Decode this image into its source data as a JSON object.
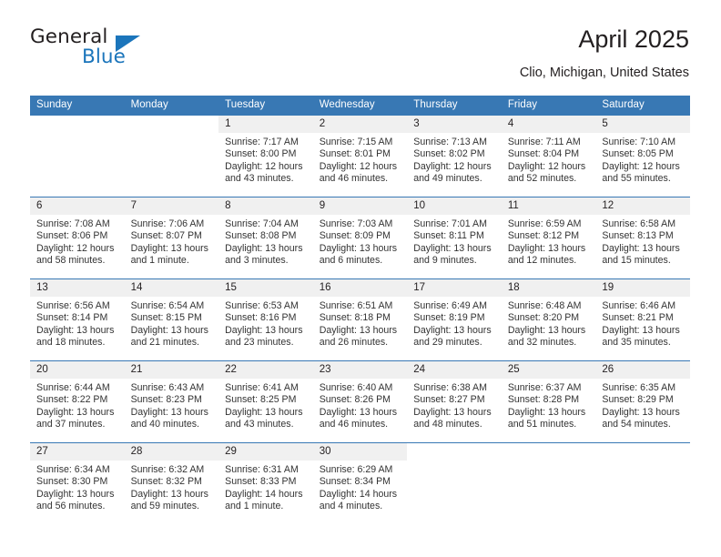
{
  "logo": {
    "primary_text": "General",
    "secondary_text": "Blue",
    "primary_color": "#231f20",
    "secondary_color": "#1b75bb"
  },
  "header": {
    "title": "April 2025",
    "location": "Clio, Michigan, United States"
  },
  "theme": {
    "header_bg": "#3878b4",
    "header_text": "#ffffff",
    "daynum_bg": "#f0f0f0",
    "cell_bg": "#ffffff",
    "row_border": "#3878b4",
    "body_text": "#333333"
  },
  "weekday_headers": [
    "Sunday",
    "Monday",
    "Tuesday",
    "Wednesday",
    "Thursday",
    "Friday",
    "Saturday"
  ],
  "weeks": [
    [
      {
        "day": "",
        "sunrise": "",
        "sunset": "",
        "daylight_1": "",
        "daylight_2": "",
        "blank": true
      },
      {
        "day": "",
        "sunrise": "",
        "sunset": "",
        "daylight_1": "",
        "daylight_2": "",
        "blank": true
      },
      {
        "day": "1",
        "sunrise": "Sunrise: 7:17 AM",
        "sunset": "Sunset: 8:00 PM",
        "daylight_1": "Daylight: 12 hours",
        "daylight_2": "and 43 minutes."
      },
      {
        "day": "2",
        "sunrise": "Sunrise: 7:15 AM",
        "sunset": "Sunset: 8:01 PM",
        "daylight_1": "Daylight: 12 hours",
        "daylight_2": "and 46 minutes."
      },
      {
        "day": "3",
        "sunrise": "Sunrise: 7:13 AM",
        "sunset": "Sunset: 8:02 PM",
        "daylight_1": "Daylight: 12 hours",
        "daylight_2": "and 49 minutes."
      },
      {
        "day": "4",
        "sunrise": "Sunrise: 7:11 AM",
        "sunset": "Sunset: 8:04 PM",
        "daylight_1": "Daylight: 12 hours",
        "daylight_2": "and 52 minutes."
      },
      {
        "day": "5",
        "sunrise": "Sunrise: 7:10 AM",
        "sunset": "Sunset: 8:05 PM",
        "daylight_1": "Daylight: 12 hours",
        "daylight_2": "and 55 minutes."
      }
    ],
    [
      {
        "day": "6",
        "sunrise": "Sunrise: 7:08 AM",
        "sunset": "Sunset: 8:06 PM",
        "daylight_1": "Daylight: 12 hours",
        "daylight_2": "and 58 minutes."
      },
      {
        "day": "7",
        "sunrise": "Sunrise: 7:06 AM",
        "sunset": "Sunset: 8:07 PM",
        "daylight_1": "Daylight: 13 hours",
        "daylight_2": "and 1 minute."
      },
      {
        "day": "8",
        "sunrise": "Sunrise: 7:04 AM",
        "sunset": "Sunset: 8:08 PM",
        "daylight_1": "Daylight: 13 hours",
        "daylight_2": "and 3 minutes."
      },
      {
        "day": "9",
        "sunrise": "Sunrise: 7:03 AM",
        "sunset": "Sunset: 8:09 PM",
        "daylight_1": "Daylight: 13 hours",
        "daylight_2": "and 6 minutes."
      },
      {
        "day": "10",
        "sunrise": "Sunrise: 7:01 AM",
        "sunset": "Sunset: 8:11 PM",
        "daylight_1": "Daylight: 13 hours",
        "daylight_2": "and 9 minutes."
      },
      {
        "day": "11",
        "sunrise": "Sunrise: 6:59 AM",
        "sunset": "Sunset: 8:12 PM",
        "daylight_1": "Daylight: 13 hours",
        "daylight_2": "and 12 minutes."
      },
      {
        "day": "12",
        "sunrise": "Sunrise: 6:58 AM",
        "sunset": "Sunset: 8:13 PM",
        "daylight_1": "Daylight: 13 hours",
        "daylight_2": "and 15 minutes."
      }
    ],
    [
      {
        "day": "13",
        "sunrise": "Sunrise: 6:56 AM",
        "sunset": "Sunset: 8:14 PM",
        "daylight_1": "Daylight: 13 hours",
        "daylight_2": "and 18 minutes."
      },
      {
        "day": "14",
        "sunrise": "Sunrise: 6:54 AM",
        "sunset": "Sunset: 8:15 PM",
        "daylight_1": "Daylight: 13 hours",
        "daylight_2": "and 21 minutes."
      },
      {
        "day": "15",
        "sunrise": "Sunrise: 6:53 AM",
        "sunset": "Sunset: 8:16 PM",
        "daylight_1": "Daylight: 13 hours",
        "daylight_2": "and 23 minutes."
      },
      {
        "day": "16",
        "sunrise": "Sunrise: 6:51 AM",
        "sunset": "Sunset: 8:18 PM",
        "daylight_1": "Daylight: 13 hours",
        "daylight_2": "and 26 minutes."
      },
      {
        "day": "17",
        "sunrise": "Sunrise: 6:49 AM",
        "sunset": "Sunset: 8:19 PM",
        "daylight_1": "Daylight: 13 hours",
        "daylight_2": "and 29 minutes."
      },
      {
        "day": "18",
        "sunrise": "Sunrise: 6:48 AM",
        "sunset": "Sunset: 8:20 PM",
        "daylight_1": "Daylight: 13 hours",
        "daylight_2": "and 32 minutes."
      },
      {
        "day": "19",
        "sunrise": "Sunrise: 6:46 AM",
        "sunset": "Sunset: 8:21 PM",
        "daylight_1": "Daylight: 13 hours",
        "daylight_2": "and 35 minutes."
      }
    ],
    [
      {
        "day": "20",
        "sunrise": "Sunrise: 6:44 AM",
        "sunset": "Sunset: 8:22 PM",
        "daylight_1": "Daylight: 13 hours",
        "daylight_2": "and 37 minutes."
      },
      {
        "day": "21",
        "sunrise": "Sunrise: 6:43 AM",
        "sunset": "Sunset: 8:23 PM",
        "daylight_1": "Daylight: 13 hours",
        "daylight_2": "and 40 minutes."
      },
      {
        "day": "22",
        "sunrise": "Sunrise: 6:41 AM",
        "sunset": "Sunset: 8:25 PM",
        "daylight_1": "Daylight: 13 hours",
        "daylight_2": "and 43 minutes."
      },
      {
        "day": "23",
        "sunrise": "Sunrise: 6:40 AM",
        "sunset": "Sunset: 8:26 PM",
        "daylight_1": "Daylight: 13 hours",
        "daylight_2": "and 46 minutes."
      },
      {
        "day": "24",
        "sunrise": "Sunrise: 6:38 AM",
        "sunset": "Sunset: 8:27 PM",
        "daylight_1": "Daylight: 13 hours",
        "daylight_2": "and 48 minutes."
      },
      {
        "day": "25",
        "sunrise": "Sunrise: 6:37 AM",
        "sunset": "Sunset: 8:28 PM",
        "daylight_1": "Daylight: 13 hours",
        "daylight_2": "and 51 minutes."
      },
      {
        "day": "26",
        "sunrise": "Sunrise: 6:35 AM",
        "sunset": "Sunset: 8:29 PM",
        "daylight_1": "Daylight: 13 hours",
        "daylight_2": "and 54 minutes."
      }
    ],
    [
      {
        "day": "27",
        "sunrise": "Sunrise: 6:34 AM",
        "sunset": "Sunset: 8:30 PM",
        "daylight_1": "Daylight: 13 hours",
        "daylight_2": "and 56 minutes."
      },
      {
        "day": "28",
        "sunrise": "Sunrise: 6:32 AM",
        "sunset": "Sunset: 8:32 PM",
        "daylight_1": "Daylight: 13 hours",
        "daylight_2": "and 59 minutes."
      },
      {
        "day": "29",
        "sunrise": "Sunrise: 6:31 AM",
        "sunset": "Sunset: 8:33 PM",
        "daylight_1": "Daylight: 14 hours",
        "daylight_2": "and 1 minute."
      },
      {
        "day": "30",
        "sunrise": "Sunrise: 6:29 AM",
        "sunset": "Sunset: 8:34 PM",
        "daylight_1": "Daylight: 14 hours",
        "daylight_2": "and 4 minutes."
      },
      {
        "day": "",
        "sunrise": "",
        "sunset": "",
        "daylight_1": "",
        "daylight_2": "",
        "blank": true
      },
      {
        "day": "",
        "sunrise": "",
        "sunset": "",
        "daylight_1": "",
        "daylight_2": "",
        "blank": true
      },
      {
        "day": "",
        "sunrise": "",
        "sunset": "",
        "daylight_1": "",
        "daylight_2": "",
        "blank": true
      }
    ]
  ]
}
